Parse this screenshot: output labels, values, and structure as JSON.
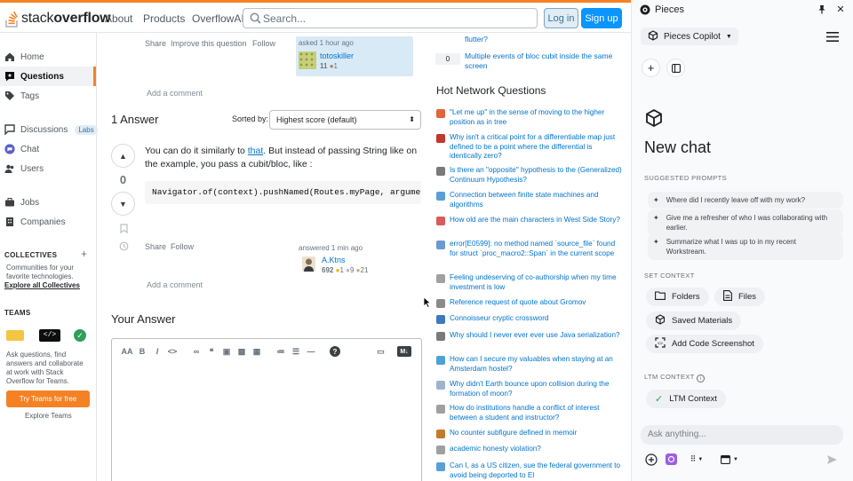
{
  "header": {
    "logo_text_light": "stack",
    "logo_text_bold": "overflow",
    "nav": [
      "About",
      "Products",
      "OverflowAI"
    ],
    "search_placeholder": "Search...",
    "login": "Log in",
    "signup": "Sign up"
  },
  "leftnav": {
    "items": [
      {
        "label": "Home",
        "icon": "home-icon"
      },
      {
        "label": "Questions",
        "icon": "questions-icon",
        "active": true
      },
      {
        "label": "Tags",
        "icon": "tag-icon"
      },
      {
        "label": "Discussions",
        "icon": "discussions-icon",
        "badge": "Labs"
      },
      {
        "label": "Chat",
        "icon": "chat-icon"
      },
      {
        "label": "Users",
        "icon": "users-icon"
      },
      {
        "label": "Jobs",
        "icon": "briefcase-icon"
      },
      {
        "label": "Companies",
        "icon": "building-icon"
      }
    ],
    "collectives_title": "COLLECTIVES",
    "collectives_desc": [
      "Communities for your",
      "favorite technologies."
    ],
    "explore_collectives": "Explore all Collectives",
    "teams_title": "TEAMS",
    "teams_desc": [
      "Ask questions, find",
      "answers and collaborate",
      "at work with Stack",
      "Overflow for Teams."
    ],
    "teams_button": "Try Teams for free",
    "explore_teams": "Explore Teams"
  },
  "question": {
    "share": "Share",
    "improve": "Improve this question",
    "follow": "Follow",
    "asked": "asked 1 hour ago",
    "asker": "totoskiller",
    "asker_rep": "11",
    "asker_bronze": "1",
    "add_comment": "Add a comment"
  },
  "answers": {
    "heading": "1 Answer",
    "sorted_by": "Sorted by:",
    "sort_value": "Highest score (default)",
    "vote_count": "0",
    "body_before_link": "You can do it similarly to ",
    "body_link": "that",
    "body_after_link": ". But instead of passing String like on the example, you pass a cubit/bloc, like :",
    "code": "Navigator.of(context).pushNamed(Routes.myPage, arguments",
    "share": "Share",
    "follow": "Follow",
    "answered": "answered 1 min ago",
    "answerer": "A.Ktns",
    "answerer_rep": "692",
    "gold": "1",
    "silver": "9",
    "bronze": "21",
    "add_comment": "Add a comment"
  },
  "your_answer": {
    "heading": "Your Answer"
  },
  "hot": {
    "top_link_1": "flutter?",
    "top_count": "0",
    "top_link_2": "Multiple events of bloc cubit inside the same screen",
    "title": "Hot Network Questions",
    "items": [
      {
        "q": "\"Let me up\" in the sense of moving to the higher position as in tree",
        "color": "#e0653a"
      },
      {
        "q": "Why isn't a critical point for a differentiable map just defined to be a point where the differential is identically zero?",
        "color": "#c0392b"
      },
      {
        "q": "Is there an \"opposite\" hypothesis to the (Generalized) Continuum Hypothesis?",
        "color": "#7a7a7a"
      },
      {
        "q": "Connection between finite state machines and algorithms",
        "color": "#5aa0d8"
      },
      {
        "q": "How old are the main characters in West Side Story?",
        "color": "#d95b5b"
      },
      {
        "q": "error[E0599]: no method named `source_file` found for struct `proc_macro2::Span` in the current scope",
        "color": "#6a9ad0"
      },
      {
        "q": "Feeling undeserving of co-authorship when my time investment is low",
        "color": "#a0a0a0"
      },
      {
        "q": "Reference request of quote about Gromov",
        "color": "#8a8a8a"
      },
      {
        "q": "Connoisseur cryptic crossword",
        "color": "#3a7bbf"
      },
      {
        "q": "Why should I never ever ever use Java serialization?",
        "color": "#7a7a7a"
      },
      {
        "q": "How can I secure my valuables when staying at an Amsterdam hostel?",
        "color": "#4aa3d8"
      },
      {
        "q": "Why didn't Earth bounce upon collision during the formation of moon?",
        "color": "#9bb5cc"
      },
      {
        "q": "How do institutions handle a conflict of interest between a student and instructor?",
        "color": "#a0a0a0"
      },
      {
        "q": "No counter subfigure defined in memoir",
        "color": "#c47a2c"
      },
      {
        "q": "academic honesty violation?",
        "color": "#a0a0a0"
      },
      {
        "q": "Can I, as a US citizen, sue the federal government to avoid being deported to El",
        "color": "#5aa0d8"
      }
    ]
  },
  "pieces": {
    "title": "Pieces",
    "copilot": "Pieces Copilot",
    "new_chat": "New chat",
    "suggested_title": "SUGGESTED PROMPTS",
    "prompts": [
      "Where did I recently leave off with my work?",
      "Give me a refresher of who I was collaborating with earlier.",
      "Summarize what I was up to in my recent Workstream."
    ],
    "set_context_title": "SET CONTEXT",
    "ctx_folders": "Folders",
    "ctx_files": "Files",
    "ctx_saved": "Saved Materials",
    "ctx_screenshot": "Add Code Screenshot",
    "ltm_title": "LTM CONTEXT",
    "ltm_button": "LTM Context",
    "ask_placeholder": "Ask anything..."
  },
  "colors": {
    "so_orange": "#f48225",
    "so_blue": "#0a95ff",
    "link_blue": "#0074cc",
    "pieces_bg": "#f9fafb"
  }
}
